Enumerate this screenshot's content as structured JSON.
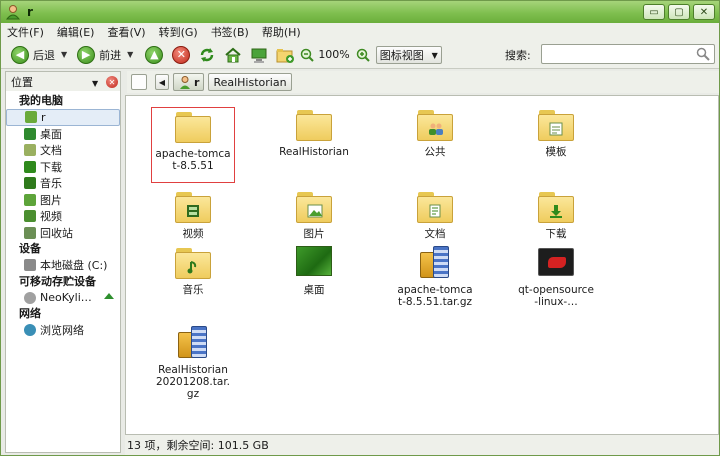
{
  "window": {
    "title": "r",
    "btn_min": "▭",
    "btn_max": "▢",
    "btn_close": "✕"
  },
  "menu": [
    "文件(F)",
    "编辑(E)",
    "查看(V)",
    "转到(G)",
    "书签(B)",
    "帮助(H)"
  ],
  "toolbar": {
    "back_label": "后退",
    "forward_label": "前进",
    "zoom": "100%",
    "view_mode": "图标视图",
    "search_label": "搜索:"
  },
  "side": {
    "header": "位置",
    "groups": [
      {
        "title": "我的电脑",
        "items": [
          {
            "label": "r",
            "icon": "home-icon",
            "selected": true
          },
          {
            "label": "桌面",
            "icon": "desktop-icon"
          },
          {
            "label": "文档",
            "icon": "document-icon"
          },
          {
            "label": "下载",
            "icon": "download-icon"
          },
          {
            "label": "音乐",
            "icon": "music-icon"
          },
          {
            "label": "图片",
            "icon": "picture-icon"
          },
          {
            "label": "视频",
            "icon": "video-icon"
          },
          {
            "label": "回收站",
            "icon": "trash-icon"
          }
        ]
      },
      {
        "title": "设备",
        "items": [
          {
            "label": "本地磁盘 (C:)",
            "icon": "drive-icon"
          }
        ]
      },
      {
        "title": "可移动存贮设备",
        "items": [
          {
            "label": "NeoKyli…",
            "icon": "disc-icon",
            "eject": true
          }
        ]
      },
      {
        "title": "网络",
        "items": [
          {
            "label": "浏览网络",
            "icon": "network-icon"
          }
        ]
      }
    ]
  },
  "pathbar": {
    "crumbs": [
      "r",
      "RealHistorian"
    ]
  },
  "files": [
    {
      "label": "apache-tomcat-8.5.51",
      "type": "folder",
      "selected": true
    },
    {
      "label": "RealHistorian",
      "type": "folder"
    },
    {
      "label": "公共",
      "type": "folder",
      "emblem": "people"
    },
    {
      "label": "模板",
      "type": "folder",
      "emblem": "template"
    },
    {
      "label": "视频",
      "type": "folder",
      "emblem": "video"
    },
    {
      "label": "图片",
      "type": "folder",
      "emblem": "picture"
    },
    {
      "label": "文档",
      "type": "folder",
      "emblem": "document"
    },
    {
      "label": "下载",
      "type": "folder",
      "emblem": "download"
    },
    {
      "label": "音乐",
      "type": "folder",
      "emblem": "music"
    },
    {
      "label": "桌面",
      "type": "desktop"
    },
    {
      "label": "apache-tomcat-8.5.51.tar.gz",
      "type": "archive"
    },
    {
      "label": "qt-opensource-linux-…",
      "type": "qt"
    },
    {
      "label": "RealHistorian20201208.tar.gz",
      "type": "archive"
    }
  ],
  "status": {
    "text": "13 项，剩余空间: 101.5 GB"
  }
}
